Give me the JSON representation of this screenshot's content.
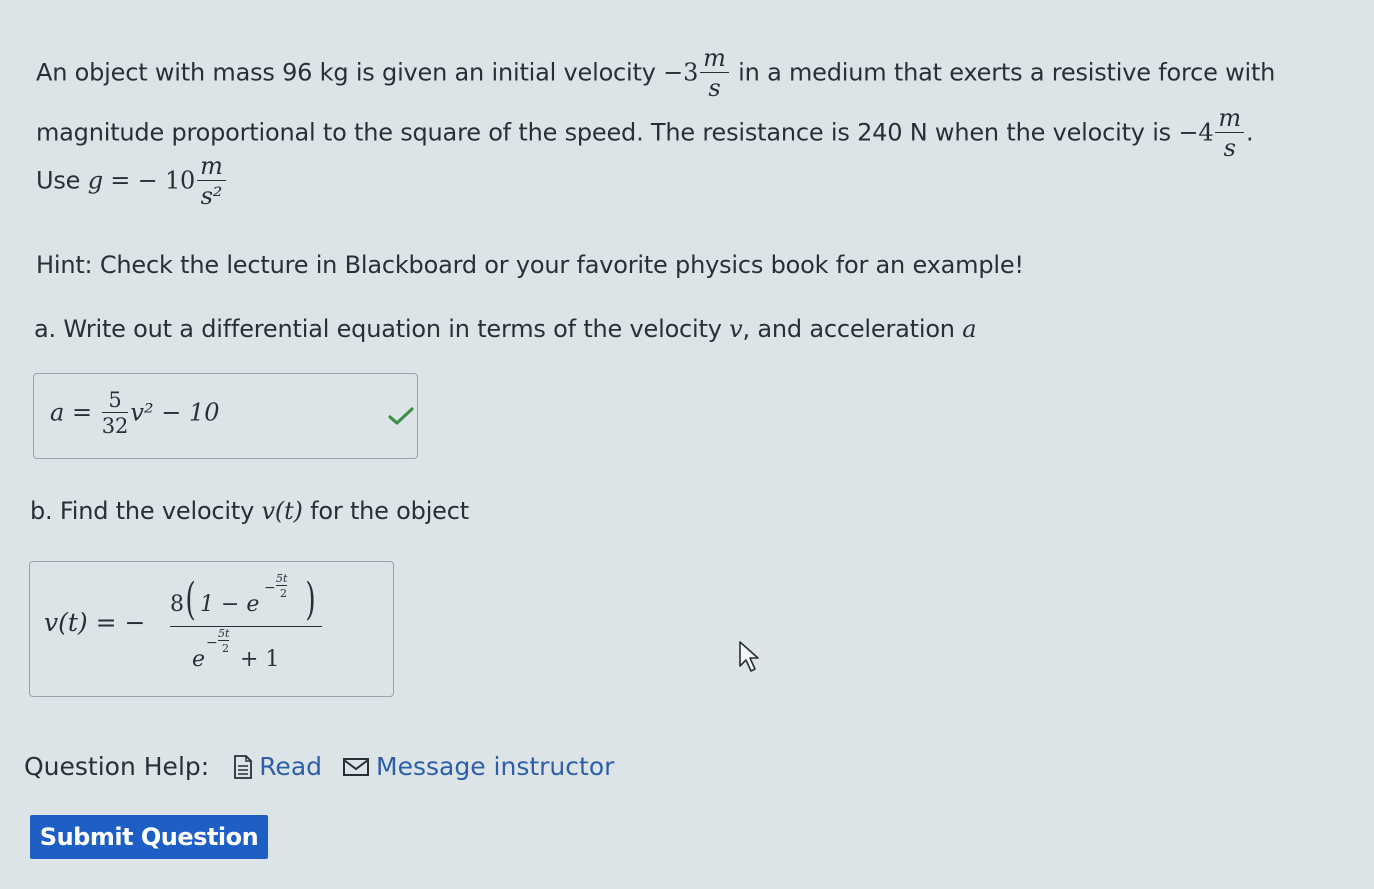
{
  "problem": {
    "line1_prefix": "An object with mass 96 kg is given an initial velocity",
    "v0_coef": "−3",
    "unit_num": "m",
    "unit_den": "s",
    "line1_suffix": "in a medium that exerts a resistive force with",
    "line2_prefix": "magnitude proportional to the square of the speed. The resistance is 240 N when the velocity is",
    "v1_coef": "−4",
    "line2_suffix": ".",
    "line3_prefix": "Use",
    "g_lhs": "g =",
    "g_coef": "− 10",
    "g_unit_num": "m",
    "g_unit_den": "s²"
  },
  "hint": "Hint: Check the lecture in Blackboard or your favorite physics book for an example!",
  "part_a": {
    "prompt_prefix": "a. Write out a differential equation in terms of the velocity",
    "var_v": "v",
    "prompt_mid": ", and acceleration",
    "var_a": "a",
    "answer_lhs": "a =",
    "answer_frac_num": "5",
    "answer_frac_den": "32",
    "answer_rest": "v² − 10",
    "status": "correct"
  },
  "part_b": {
    "prompt_prefix": "b. Find the velocity",
    "var_vt": "v(t)",
    "prompt_suffix": "for the object",
    "answer_lhs": "v(t) = −",
    "num_coef": "8",
    "num_inner": "1 − e",
    "exp_num": "5t",
    "exp_den": "2",
    "exp_sign": "−",
    "den_base": "e",
    "den_tail": "+ 1"
  },
  "help": {
    "label": "Question Help:",
    "read_label": "Read",
    "message_label": "Message instructor"
  },
  "submit_label": "Submit Question",
  "colors": {
    "background": "#dde4e8",
    "link": "#2d5fa8",
    "submit": "#1d5fc4",
    "check": "#3f8f4a"
  }
}
